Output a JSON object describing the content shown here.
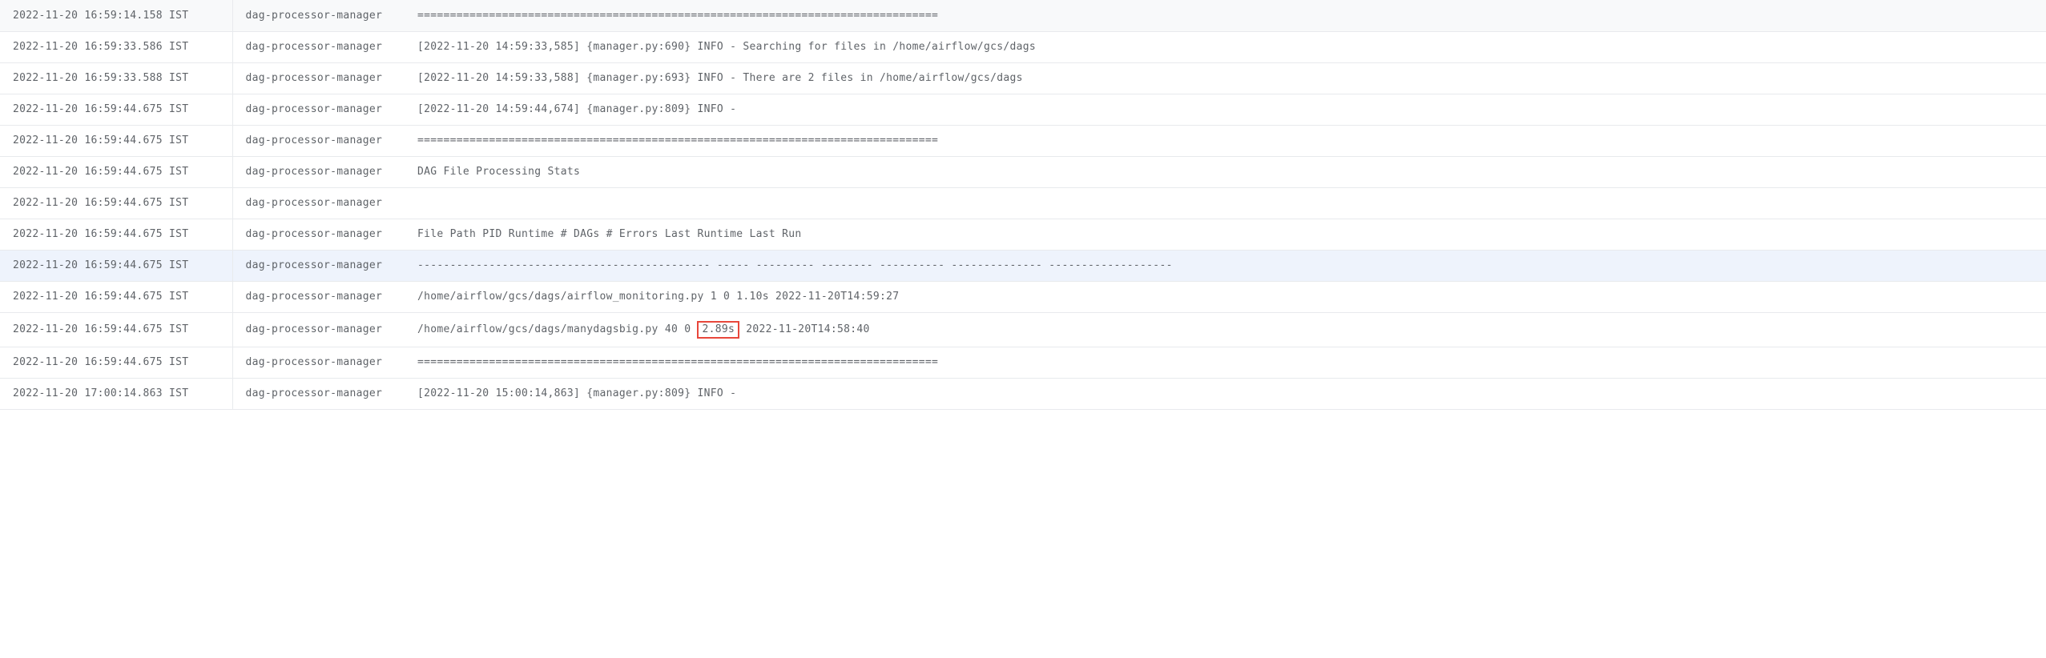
{
  "rows": [
    {
      "timestamp": "2022-11-20 16:59:14.158 IST",
      "source": "dag-processor-manager",
      "message": "================================================================================",
      "highlighted": false
    },
    {
      "timestamp": "2022-11-20 16:59:33.586 IST",
      "source": "dag-processor-manager",
      "message": "[2022-11-20 14:59:33,585] {manager.py:690} INFO - Searching for files in /home/airflow/gcs/dags",
      "highlighted": false
    },
    {
      "timestamp": "2022-11-20 16:59:33.588 IST",
      "source": "dag-processor-manager",
      "message": "[2022-11-20 14:59:33,588] {manager.py:693} INFO - There are 2 files in /home/airflow/gcs/dags",
      "highlighted": false
    },
    {
      "timestamp": "2022-11-20 16:59:44.675 IST",
      "source": "dag-processor-manager",
      "message": "[2022-11-20 14:59:44,674] {manager.py:809} INFO -",
      "highlighted": false
    },
    {
      "timestamp": "2022-11-20 16:59:44.675 IST",
      "source": "dag-processor-manager",
      "message": "================================================================================",
      "highlighted": false
    },
    {
      "timestamp": "2022-11-20 16:59:44.675 IST",
      "source": "dag-processor-manager",
      "message": "DAG File Processing Stats",
      "highlighted": false
    },
    {
      "timestamp": "2022-11-20 16:59:44.675 IST",
      "source": "dag-processor-manager",
      "message": "",
      "highlighted": false
    },
    {
      "timestamp": "2022-11-20 16:59:44.675 IST",
      "source": "dag-processor-manager",
      "message": "File Path PID Runtime # DAGs # Errors Last Runtime Last Run",
      "highlighted": false
    },
    {
      "timestamp": "2022-11-20 16:59:44.675 IST",
      "source": "dag-processor-manager",
      "message": "--------------------------------------------- ----- --------- -------- ---------- -------------- -------------------",
      "highlighted": true
    },
    {
      "timestamp": "2022-11-20 16:59:44.675 IST",
      "source": "dag-processor-manager",
      "message": "/home/airflow/gcs/dags/airflow_monitoring.py 1 0 1.10s 2022-11-20T14:59:27",
      "highlighted": false
    },
    {
      "timestamp": "2022-11-20 16:59:44.675 IST",
      "source": "dag-processor-manager",
      "message_prefix": "/home/airflow/gcs/dags/manydagsbig.py 40 0 ",
      "message_boxed": "2.89s",
      "message_suffix": " 2022-11-20T14:58:40",
      "highlighted": false,
      "has_box": true
    },
    {
      "timestamp": "2022-11-20 16:59:44.675 IST",
      "source": "dag-processor-manager",
      "message": "================================================================================",
      "highlighted": false
    },
    {
      "timestamp": "2022-11-20 17:00:14.863 IST",
      "source": "dag-processor-manager",
      "message": "[2022-11-20 15:00:14,863] {manager.py:809} INFO -",
      "highlighted": false
    }
  ]
}
